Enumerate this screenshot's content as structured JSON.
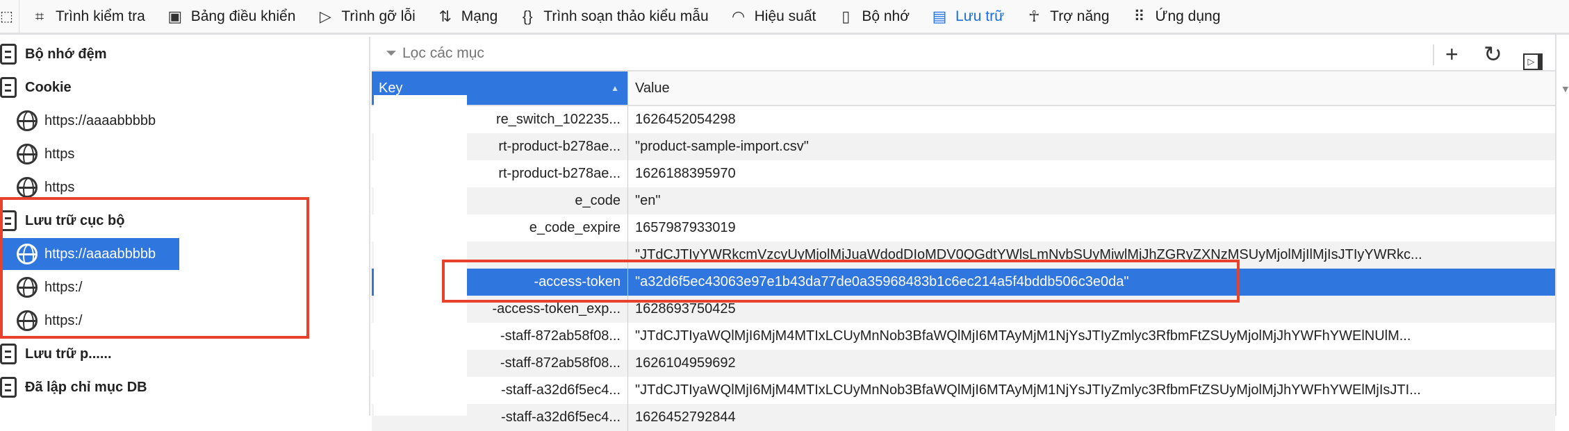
{
  "toolbar": {
    "tabs": [
      {
        "label": "Trình kiểm tra",
        "icon": "inspector-icon"
      },
      {
        "label": "Bảng điều khiển",
        "icon": "console-icon"
      },
      {
        "label": "Trình gỡ lỗi",
        "icon": "debugger-icon"
      },
      {
        "label": "Mạng",
        "icon": "network-icon"
      },
      {
        "label": "Trình soạn thảo kiểu mẫu",
        "icon": "style-editor-icon"
      },
      {
        "label": "Hiệu suất",
        "icon": "performance-icon"
      },
      {
        "label": "Bộ nhớ",
        "icon": "memory-icon"
      },
      {
        "label": "Lưu trữ",
        "icon": "storage-icon",
        "active": true
      },
      {
        "label": "Trợ năng",
        "icon": "accessibility-icon"
      },
      {
        "label": "Ứng dụng",
        "icon": "application-icon"
      }
    ],
    "accent": "#1a6ee0"
  },
  "sidebar": {
    "items": [
      {
        "label": "Bộ nhớ đệm",
        "type": "group"
      },
      {
        "label": "Cookie",
        "type": "group"
      },
      {
        "label": "https://aaaabbbbb",
        "type": "child"
      },
      {
        "label": "https",
        "type": "child"
      },
      {
        "label": "https",
        "type": "child"
      },
      {
        "label": "Lưu trữ cục bộ",
        "type": "group"
      },
      {
        "label": "https://aaaabbbbb",
        "type": "child",
        "selected": true
      },
      {
        "label": "https:/",
        "type": "child"
      },
      {
        "label": "https:/",
        "type": "child"
      },
      {
        "label": "Lưu trữ p......",
        "type": "group"
      },
      {
        "label": "Đã lập chỉ mục DB",
        "type": "group"
      }
    ]
  },
  "filter": {
    "placeholder": "Lọc các mục"
  },
  "table": {
    "columns": [
      "Key",
      "Value"
    ],
    "rows": [
      {
        "key": "re_switch_102235...",
        "value": "1626452054298"
      },
      {
        "key": "rt-product-b278ae...",
        "value": "\"product-sample-import.csv\""
      },
      {
        "key": "rt-product-b278ae...",
        "value": "1626188395970"
      },
      {
        "key": "e_code",
        "value": "\"en\""
      },
      {
        "key": "e_code_expire",
        "value": "1657987933019"
      },
      {
        "key": "",
        "value": "\"JTdCJTIyYWRkcmVzcyUyMjolMjJuaWdodDIoMDV0QGdtYWlsLmNvbSUyMiwlMjJhZGRyZXNzMSUyMjolMjIlMjIsJTIyYWRkc..."
      },
      {
        "key": "-access-token",
        "value": "\"a32d6f5ec43063e97e1b43da77de0a35968483b1c6ec214a5f4bddb506c3e0da\"",
        "selected": true
      },
      {
        "key": "-access-token_exp...",
        "value": "1628693750425"
      },
      {
        "key": "-staff-872ab58f08...",
        "value": "\"JTdCJTIyaWQlMjI6MjM4MTIxLCUyMnNob3BfaWQlMjI6MTAyMjM1NjYsJTIyZmlyc3RfbmFtZSUyMjolMjJhYWFhYWElNUlM..."
      },
      {
        "key": "-staff-872ab58f08...",
        "value": "1626104959692"
      },
      {
        "key": "-staff-a32d6f5ec4...",
        "value": "\"JTdCJTIyaWQlMjI6MjM4MTIxLCUyMnNob3BfaWQlMjI6MTAyMjM1NjYsJTIyZmlyc3RfbmFtZSUyMjolMjJhYWFhYWElMjIsJTI..."
      },
      {
        "key": "-staff-a32d6f5ec4...",
        "value": "1626452792844"
      }
    ]
  }
}
